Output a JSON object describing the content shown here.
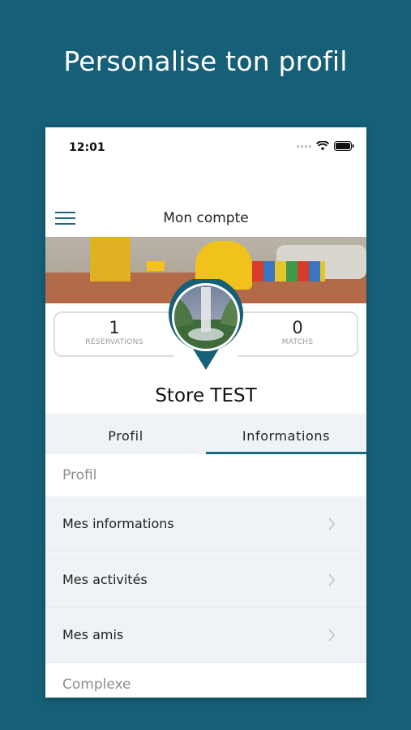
{
  "promo": {
    "title": "Personalise ton profil"
  },
  "status_bar": {
    "time": "12:01"
  },
  "header": {
    "title": "Mon compte",
    "menu_icon": "hamburger-icon"
  },
  "stats": [
    {
      "value": "1",
      "label": "RÉSERVATIONS"
    },
    {
      "value": "0",
      "label": "MATCHS"
    }
  ],
  "profile": {
    "name": "Store TEST"
  },
  "tabs": [
    {
      "label": "Profil",
      "active": false
    },
    {
      "label": "Informations",
      "active": true
    }
  ],
  "sections": [
    {
      "title": "Profil",
      "items": [
        {
          "label": "Mes informations",
          "icon": "chevron-right-icon"
        },
        {
          "label": "Mes activités",
          "icon": "chevron-right-icon"
        },
        {
          "label": "Mes amis",
          "icon": "chevron-right-icon"
        }
      ]
    },
    {
      "title": "Complexe",
      "items": []
    }
  ],
  "colors": {
    "background": "#155f77",
    "accent": "#1d6a80",
    "list_bg": "#f0f3f6",
    "muted_text": "#8d8d8d"
  }
}
